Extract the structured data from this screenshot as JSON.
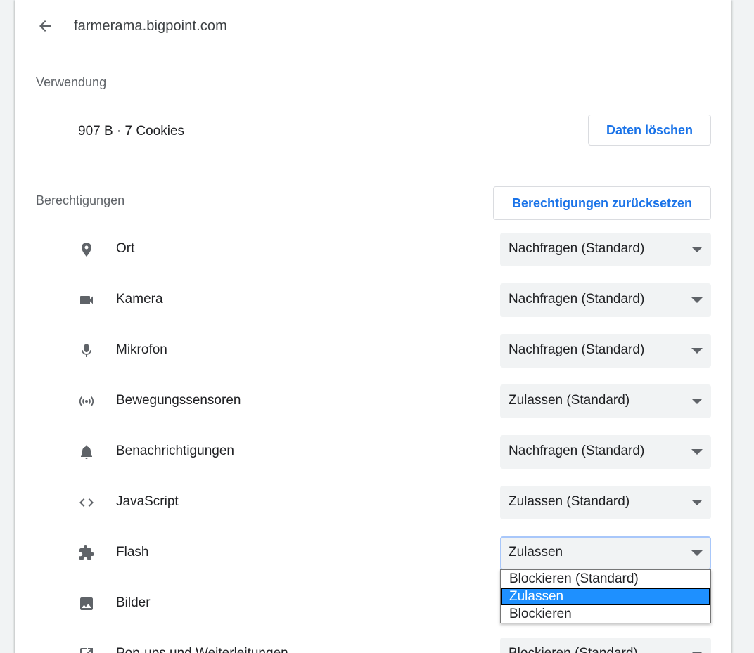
{
  "header": {
    "site": "farmerama.bigpoint.com"
  },
  "usage": {
    "heading": "Verwendung",
    "summary": "907 B · 7 Cookies",
    "clear_button": "Daten löschen"
  },
  "permissions": {
    "heading": "Berechtigungen",
    "reset_button": "Berechtigungen zurücksetzen",
    "items": [
      {
        "label": "Ort",
        "icon": "location-pin-icon",
        "value": "Nachfragen (Standard)"
      },
      {
        "label": "Kamera",
        "icon": "camera-icon",
        "value": "Nachfragen (Standard)"
      },
      {
        "label": "Mikrofon",
        "icon": "microphone-icon",
        "value": "Nachfragen (Standard)"
      },
      {
        "label": "Bewegungssensoren",
        "icon": "motion-sensor-icon",
        "value": "Zulassen (Standard)"
      },
      {
        "label": "Benachrichtigungen",
        "icon": "bell-icon",
        "value": "Nachfragen (Standard)"
      },
      {
        "label": "JavaScript",
        "icon": "code-icon",
        "value": "Zulassen (Standard)"
      },
      {
        "label": "Flash",
        "icon": "puzzle-icon",
        "value": "Zulassen"
      },
      {
        "label": "Bilder",
        "icon": "image-icon",
        "value": ""
      },
      {
        "label": "Pop-ups und Weiterleitungen",
        "icon": "open-in-new-icon",
        "value": "Blockieren (Standard)"
      }
    ],
    "flash_dropdown": {
      "options": [
        "Blockieren (Standard)",
        "Zulassen",
        "Blockieren"
      ],
      "selected": "Zulassen"
    }
  },
  "colors": {
    "accent": "#1a73e8",
    "select_bg": "#f1f3f4",
    "highlight": "#1e90ff"
  }
}
